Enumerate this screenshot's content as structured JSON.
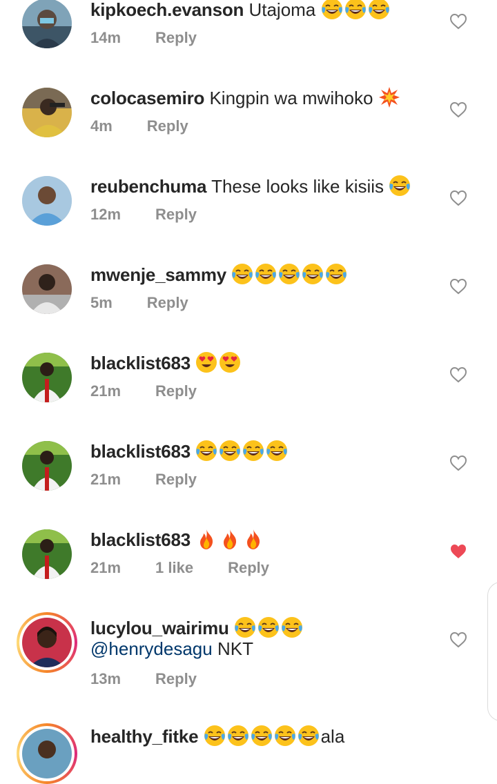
{
  "comments": [
    {
      "username": "kipkoech.evanson",
      "text": "Utajoma",
      "emoji": [
        "laugh",
        "laugh",
        "laugh"
      ],
      "time": "14m",
      "likes": "",
      "reply": "Reply",
      "liked": false
    },
    {
      "username": "colocasemiro",
      "text": "Kingpin wa mwihoko",
      "emoji": [
        "boom"
      ],
      "time": "4m",
      "likes": "",
      "reply": "Reply",
      "liked": false
    },
    {
      "username": "reubenchuma",
      "text": "These looks like kisiis",
      "emoji": [
        "laugh"
      ],
      "time": "12m",
      "likes": "",
      "reply": "Reply",
      "liked": false
    },
    {
      "username": "mwenje_sammy",
      "text": "",
      "emoji": [
        "laugh",
        "laugh",
        "laugh",
        "laugh",
        "laugh"
      ],
      "time": "5m",
      "likes": "",
      "reply": "Reply",
      "liked": false
    },
    {
      "username": "blacklist683",
      "text": "",
      "emoji": [
        "hearteyes",
        "hearteyes"
      ],
      "time": "21m",
      "likes": "",
      "reply": "Reply",
      "liked": false
    },
    {
      "username": "blacklist683",
      "text": "",
      "emoji": [
        "laugh",
        "laugh",
        "laugh",
        "laugh"
      ],
      "time": "21m",
      "likes": "",
      "reply": "Reply",
      "liked": false
    },
    {
      "username": "blacklist683",
      "text": "",
      "emoji": [
        "fire",
        "fire",
        "fire"
      ],
      "time": "21m",
      "likes": "1 like",
      "reply": "Reply",
      "liked": true
    },
    {
      "username": "lucylou_wairimu",
      "text": "",
      "emoji": [
        "laugh",
        "laugh",
        "laugh"
      ],
      "mention": "@henrydesagu",
      "text2": "NKT",
      "time": "13m",
      "likes": "",
      "reply": "Reply",
      "liked": false
    },
    {
      "username": "healthy_fitke",
      "text": "ala",
      "emoji": [
        "laugh",
        "laugh",
        "laugh",
        "laugh",
        "laugh"
      ],
      "time": "",
      "likes": "",
      "reply": "",
      "liked": false
    }
  ],
  "colors": {
    "liked": "#ed4956",
    "icon": "#8e8e8e",
    "meta": "#8e8e8e",
    "mention": "#00376b"
  }
}
